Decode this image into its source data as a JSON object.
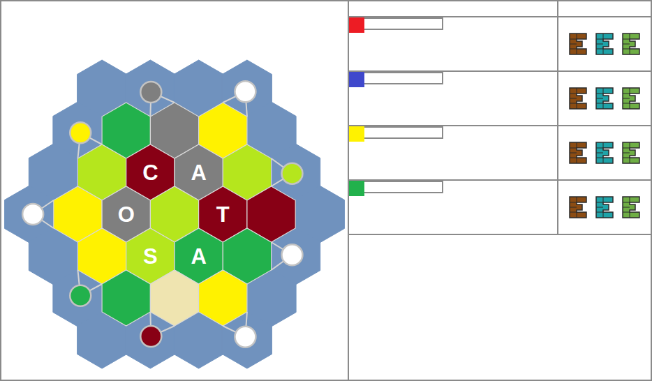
{
  "board": {
    "tiles": [
      {
        "color": "#22b14c",
        "label": ""
      },
      {
        "color": "#7f7f7f",
        "label": ""
      },
      {
        "color": "#fff200",
        "label": ""
      },
      {
        "color": "#b5e61d",
        "label": ""
      },
      {
        "color": "#880015",
        "label": "C"
      },
      {
        "color": "#7f7f7f",
        "label": "A"
      },
      {
        "color": "#b5e61d",
        "label": ""
      },
      {
        "color": "#fff200",
        "label": ""
      },
      {
        "color": "#7f7f7f",
        "label": "O"
      },
      {
        "color": "#b5e61d",
        "label": ""
      },
      {
        "color": "#880015",
        "label": "T"
      },
      {
        "color": "#880015",
        "label": ""
      },
      {
        "color": "#fff200",
        "label": ""
      },
      {
        "color": "#b5e61d",
        "label": "S"
      },
      {
        "color": "#22b14c",
        "label": "A"
      },
      {
        "color": "#22b14c",
        "label": ""
      },
      {
        "color": "#22b14c",
        "label": ""
      },
      {
        "color": "#efe4b0",
        "label": ""
      },
      {
        "color": "#fff200",
        "label": ""
      }
    ],
    "ports": [
      {
        "color": "#7f7f7f"
      },
      {
        "color": "#ffffff"
      },
      {
        "color": "#fff200"
      },
      {
        "color": "#b5e61d"
      },
      {
        "color": "#ffffff"
      },
      {
        "color": "#ffffff"
      },
      {
        "color": "#22b14c"
      },
      {
        "color": "#880015"
      },
      {
        "color": "#ffffff"
      }
    ]
  },
  "players": [
    {
      "color": "#ed1c24",
      "name": ""
    },
    {
      "color": "#3f48cc",
      "name": ""
    },
    {
      "color": "#fff200",
      "name": ""
    },
    {
      "color": "#22b14c",
      "name": ""
    }
  ],
  "pieces": [
    {
      "color": "#8b4c13"
    },
    {
      "color": "#1fa3a8"
    },
    {
      "color": "#6fae45"
    }
  ]
}
